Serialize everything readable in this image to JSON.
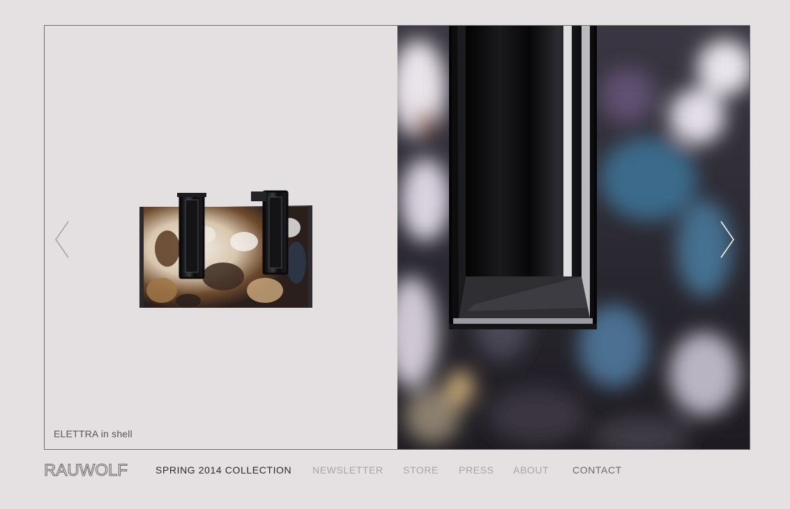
{
  "slide": {
    "caption": "ELETTRA in shell"
  },
  "brand": {
    "logo_text": "RAUWOLF"
  },
  "nav": {
    "collection": "SPRING 2014 COLLECTION",
    "newsletter": "NEWSLETTER",
    "store": "STORE",
    "press": "PRESS",
    "about": "ABOUT",
    "contact": "CONTACT"
  },
  "icons": {
    "prev": "chevron-left-icon",
    "next": "chevron-right-icon"
  },
  "colors": {
    "background": "#e5e1e2",
    "border": "#6e6b6c",
    "text_dark": "#2b2829",
    "text_muted": "#a8a4a5"
  }
}
